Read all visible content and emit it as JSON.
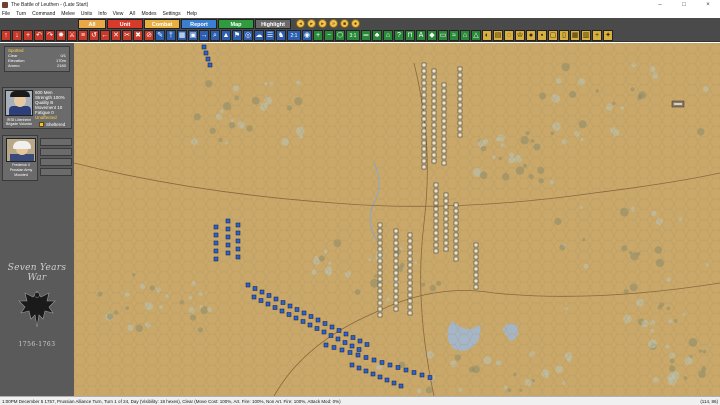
{
  "window": {
    "title": "The Battle of Leuthen - (Late Start)",
    "controls": [
      "–",
      "□",
      "×"
    ]
  },
  "menu": [
    "File",
    "Turn",
    "Command",
    "Melee",
    "Units",
    "Info",
    "View",
    "A/I",
    "Modes",
    "Settings",
    "Help"
  ],
  "modes": {
    "all": "All",
    "unit": "Unit",
    "combat": "Combat",
    "report": "Report",
    "map": "Map",
    "highlight": "Highlight"
  },
  "toolbar": {
    "ratio_label_1": "2:1",
    "ratio_label_2": "3:1"
  },
  "hex_info": {
    "header": "Spotted",
    "terrain_label": "Clear",
    "terrain_value": "0/1",
    "elevation_label": "Elevation",
    "elevation_value": "170m",
    "ammo_label": "Ammo",
    "ammo_value": "2180"
  },
  "unit": {
    "men": "600 Men",
    "strength": "Strength 100%",
    "quality": "Quality B",
    "movement": "Movement 10",
    "fatigue": "Fatigue 0",
    "state": "Unaffected",
    "name_line1": "IR35 Lilienheim",
    "name_line2": "Brigade Volontar",
    "status": "Sheltered"
  },
  "leader": {
    "name": "Frederick II",
    "army": "Prussian Army",
    "state": "Mounted"
  },
  "logo": {
    "title": "Seven Years War",
    "years": "1756-1763"
  },
  "status_bar": {
    "message": "1:00PM December 5 1757, Prussian Alliance Turn, Turn 1 of 24, Day (Visibility: 18 hexes), Clear (Move Cost: 100%, Art. Fire: 100%, Non Art. Fire: 100%, Attack Mod: 0%)",
    "coords": "(114, 86)"
  },
  "colors": {
    "map_base": "#c9a86a",
    "prussian_units": "#2f62c8",
    "austrian_units": "#e8e0c8",
    "water": "#9fb8d8"
  }
}
